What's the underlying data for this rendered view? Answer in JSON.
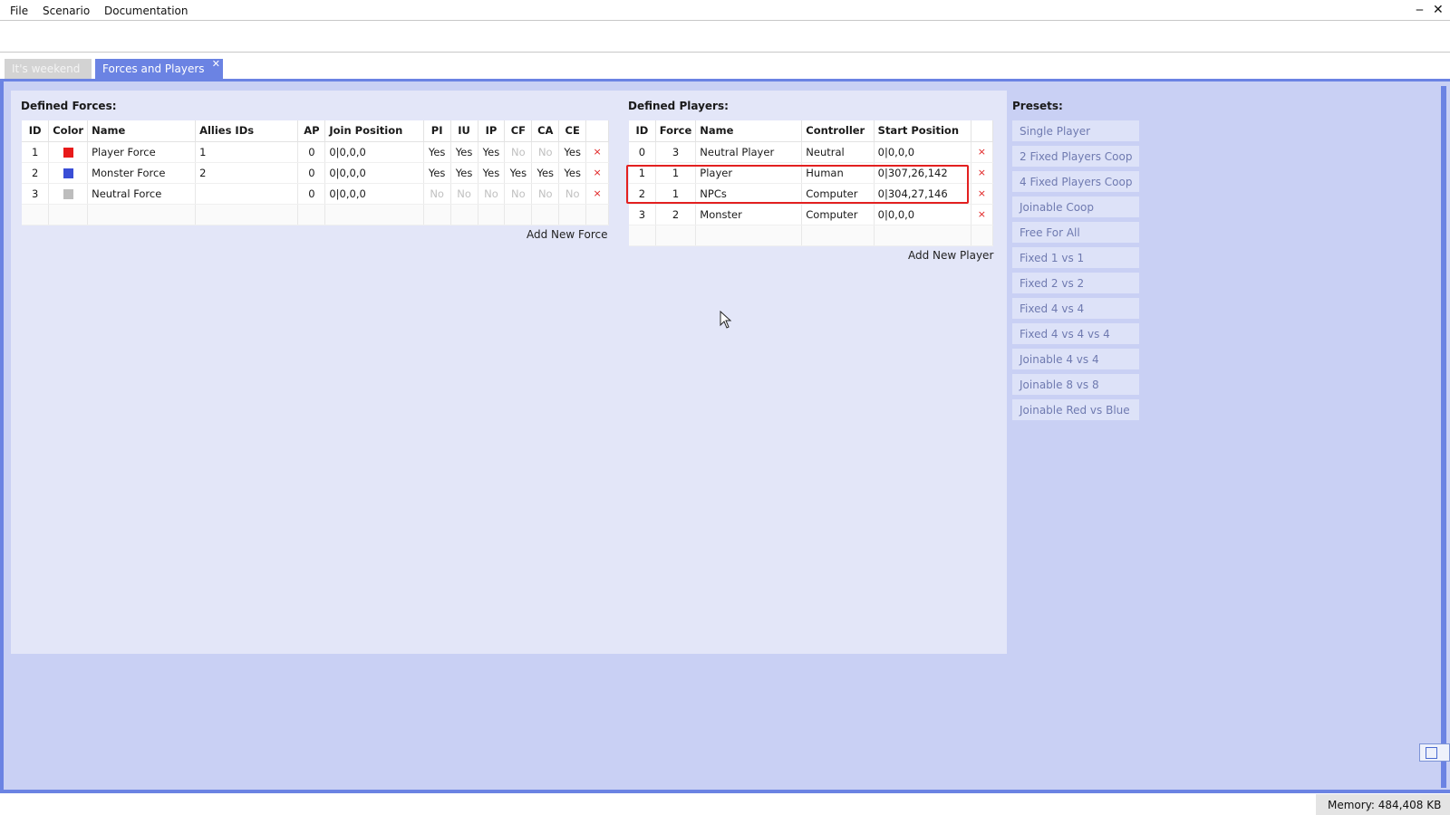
{
  "menu": {
    "items": [
      "File",
      "Scenario",
      "Documentation"
    ]
  },
  "window": {
    "minimize_glyph": "‒",
    "close_glyph": "✕"
  },
  "tabs": [
    {
      "label": "It's weekend",
      "active": false
    },
    {
      "label": "Forces and Players",
      "active": true,
      "close_glyph": "✕"
    }
  ],
  "forces": {
    "title": "Defined Forces:",
    "columns": [
      "ID",
      "Color",
      "Name",
      "Allies IDs",
      "AP",
      "Join Position",
      "PI",
      "IU",
      "IP",
      "CF",
      "CA",
      "CE"
    ],
    "rows": [
      {
        "id": "1",
        "color": "#e81a1a",
        "name": "Player Force",
        "allies": "1",
        "ap": "0",
        "join": "0|0,0,0",
        "pi": "Yes",
        "iu": "Yes",
        "ip": "Yes",
        "cf": "No",
        "ca": "No",
        "ce": "Yes"
      },
      {
        "id": "2",
        "color": "#3a4ed6",
        "name": "Monster Force",
        "allies": "2",
        "ap": "0",
        "join": "0|0,0,0",
        "pi": "Yes",
        "iu": "Yes",
        "ip": "Yes",
        "cf": "Yes",
        "ca": "Yes",
        "ce": "Yes"
      },
      {
        "id": "3",
        "color": "#bdbdbd",
        "name": "Neutral Force",
        "allies": "",
        "ap": "0",
        "join": "0|0,0,0",
        "pi": "No",
        "iu": "No",
        "ip": "No",
        "cf": "No",
        "ca": "No",
        "ce": "No"
      }
    ],
    "delete_glyph": "×",
    "add_label": "Add New Force"
  },
  "players": {
    "title": "Defined Players:",
    "columns": [
      "ID",
      "Force",
      "Name",
      "Controller",
      "Start Position"
    ],
    "rows": [
      {
        "id": "0",
        "force": "3",
        "name": "Neutral Player",
        "controller": "Neutral",
        "start": "0|0,0,0"
      },
      {
        "id": "1",
        "force": "1",
        "name": "Player",
        "controller": "Human",
        "start": "0|307,26,142"
      },
      {
        "id": "2",
        "force": "1",
        "name": "NPCs",
        "controller": "Computer",
        "start": "0|304,27,146"
      },
      {
        "id": "3",
        "force": "2",
        "name": "Monster",
        "controller": "Computer",
        "start": "0|0,0,0"
      }
    ],
    "delete_glyph": "×",
    "add_label": "Add New Player"
  },
  "presets": {
    "title": "Presets:",
    "items": [
      "Single Player",
      "2 Fixed Players Coop",
      "4 Fixed Players Coop",
      "Joinable Coop",
      "Free For All",
      "Fixed 1 vs 1",
      "Fixed 2 vs 2",
      "Fixed 4 vs 4",
      "Fixed 4 vs 4 vs 4",
      "Joinable 4 vs 4",
      "Joinable 8 vs 8",
      "Joinable Red vs Blue"
    ]
  },
  "status": {
    "memory": "Memory: 484,408 KB"
  },
  "colors": {
    "accent": "#6b83e3",
    "background": "#c9d0f4",
    "panel": "#e3e6f8",
    "highlight": "#e32020",
    "no_text": "#c0c0c0"
  }
}
